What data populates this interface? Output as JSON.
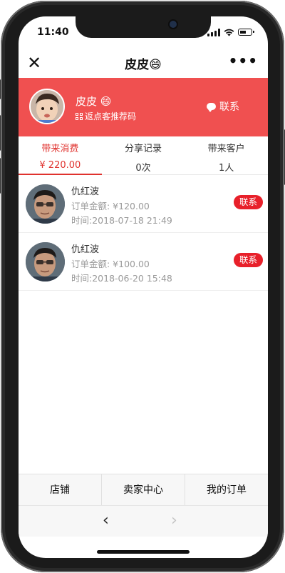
{
  "status_bar": {
    "time": "11:40"
  },
  "nav": {
    "close_glyph": "✕",
    "title": "皮皮😄",
    "more_glyph": "•••"
  },
  "profile": {
    "name": "皮皮 😄",
    "code_label": "返点客推荐码",
    "contact_label": "联系",
    "accent_color": "#f05050"
  },
  "tabs": [
    {
      "label": "带来消费",
      "value": "¥ 220.00",
      "active": true
    },
    {
      "label": "分享记录",
      "value": "0次",
      "active": false
    },
    {
      "label": "带来客户",
      "value": "1人",
      "active": false
    }
  ],
  "orders": [
    {
      "name": "仇红波",
      "amount": "订单金额: ¥120.00",
      "time": "时间:2018-07-18 21:49",
      "button": "联系"
    },
    {
      "name": "仇红波",
      "amount": "订单金额: ¥100.00",
      "time": "时间:2018-06-20 15:48",
      "button": "联系"
    }
  ],
  "bottom_tabs": [
    "店铺",
    "卖家中心",
    "我的订单"
  ],
  "browser": {
    "back_glyph": "‹",
    "forward_glyph": "›"
  }
}
